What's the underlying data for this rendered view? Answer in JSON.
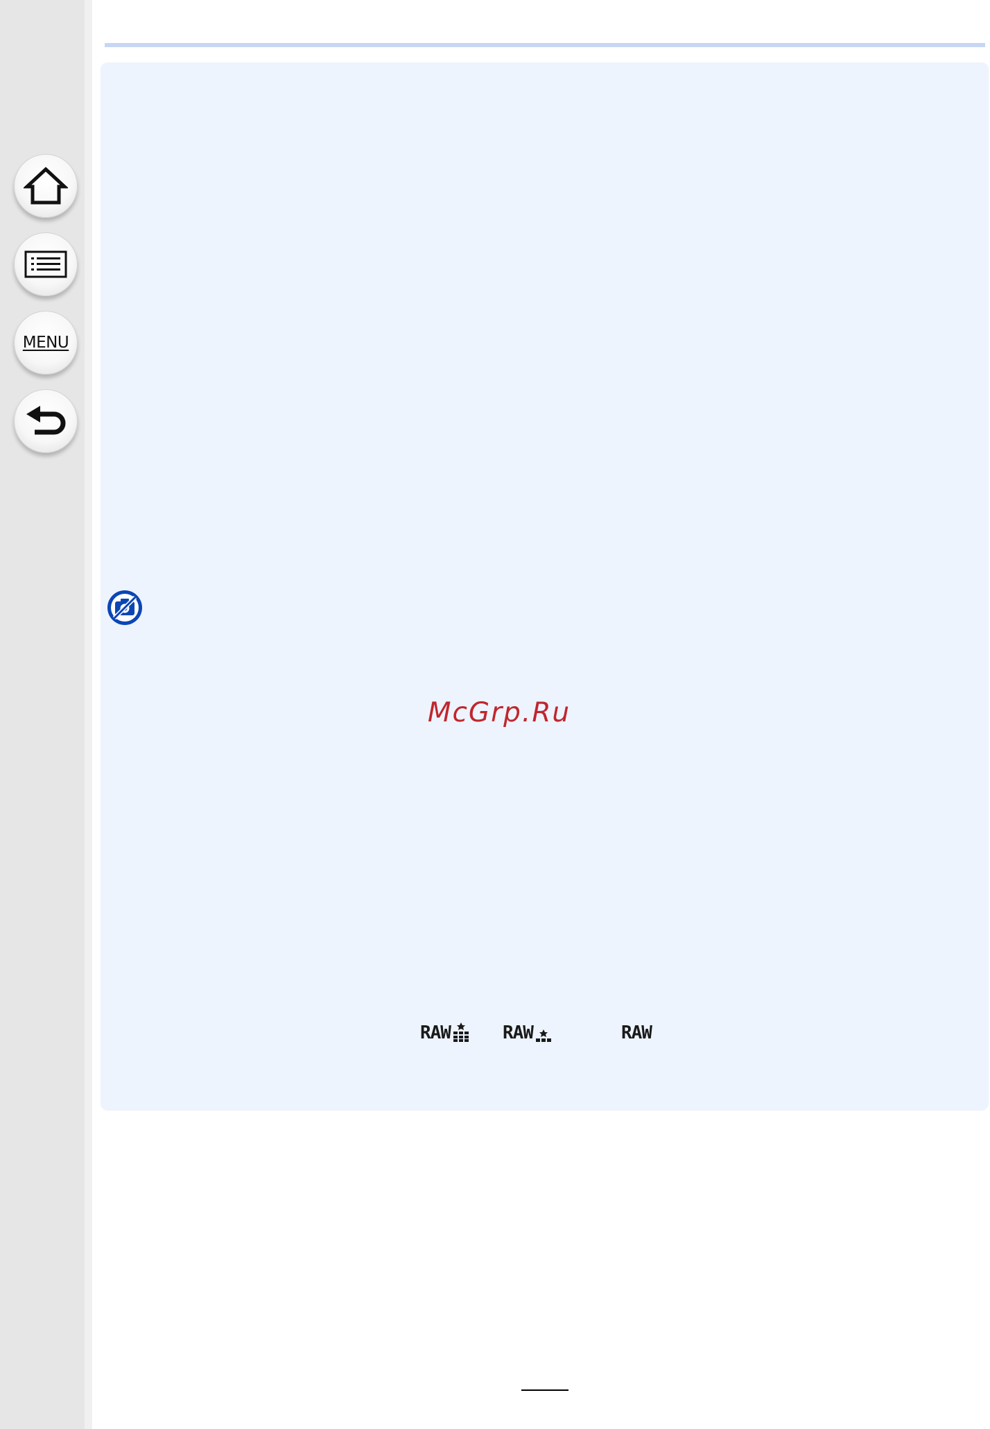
{
  "sidebar": {
    "buttons": [
      {
        "name": "home",
        "icon": "home-icon"
      },
      {
        "name": "contents",
        "icon": "list-icon"
      },
      {
        "name": "menu",
        "label": "MENU"
      },
      {
        "name": "back",
        "icon": "return-arrow-icon"
      }
    ]
  },
  "content": {
    "watermark": "McGrp.Ru",
    "no_photo_icon": "camera-not-available-icon",
    "raw_icons": [
      {
        "text": "RAW",
        "quality": "fine"
      },
      {
        "text": "RAW",
        "quality": "standard"
      },
      {
        "text": "RAW",
        "quality": "raw-only"
      }
    ]
  },
  "colors": {
    "panel_background": "#edf4fd",
    "top_rule": "#c7d6f2",
    "watermark": "#c0262e",
    "no_photo_icon": "#0b46b5",
    "sidebar": "#e6e6e6"
  }
}
